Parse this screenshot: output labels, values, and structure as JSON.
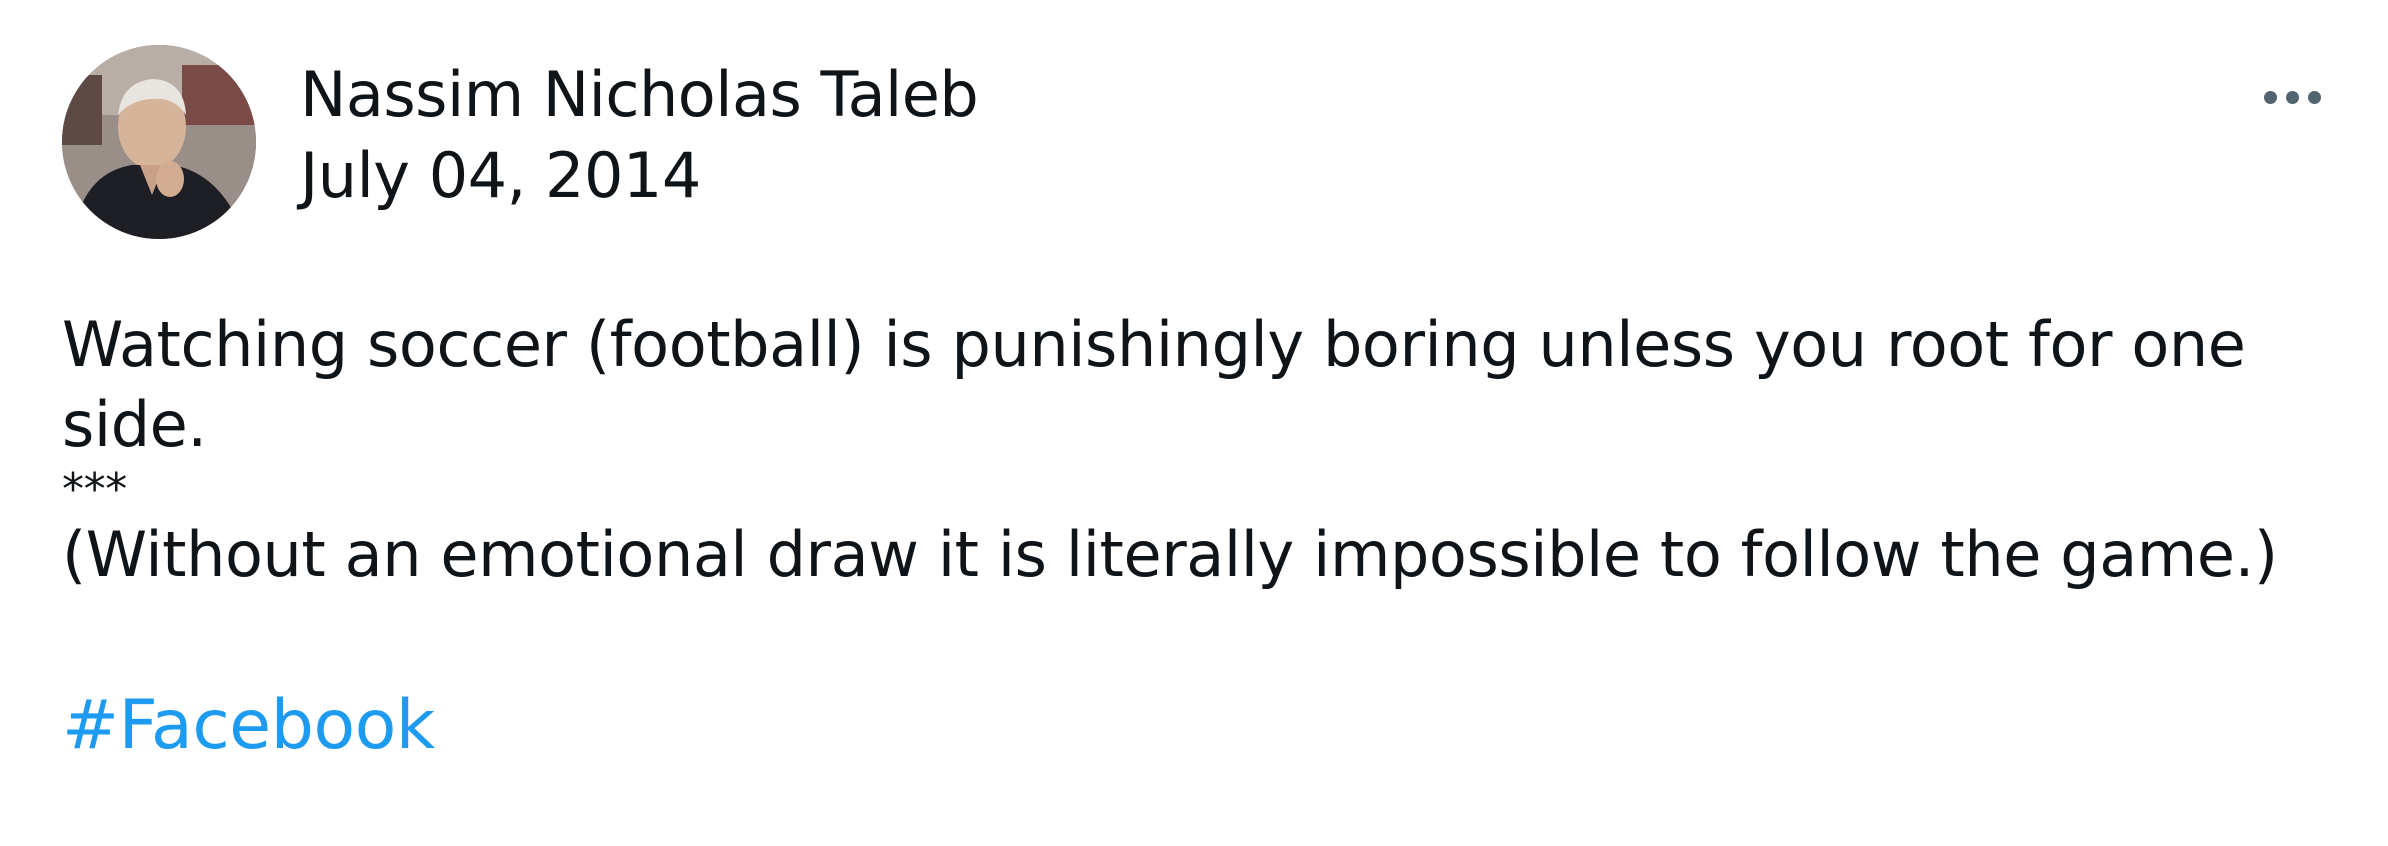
{
  "post": {
    "author_name": "Nassim Nicholas Taleb",
    "date": "July 04, 2014",
    "body_line_1": "Watching soccer (football) is punishingly boring unless you root for one",
    "body_line_2": "side.",
    "separator": "***",
    "body_line_3": "(Without an emotional draw it is literally impossible to follow the game.)",
    "hashtag": "#Facebook"
  },
  "icons": {
    "more_menu": "more-horizontal-icon",
    "avatar": "author-avatar"
  },
  "colors": {
    "text": "#0f1419",
    "hashtag": "#1d9bf0",
    "icon": "#536471",
    "background": "#ffffff"
  }
}
